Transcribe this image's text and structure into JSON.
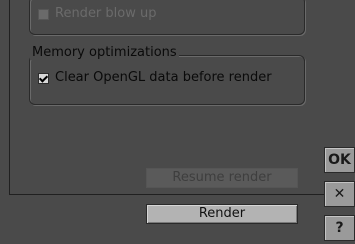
{
  "render_blowup": {
    "label": "Render blow up",
    "checked": false,
    "enabled": false
  },
  "memory": {
    "title": "Memory optimizations",
    "clear_gl": {
      "label": "Clear OpenGL data before render",
      "checked": true
    }
  },
  "buttons": {
    "resume": "Resume render",
    "render": "Render"
  },
  "side": {
    "ok": "OK",
    "close": "✕",
    "help": "?"
  }
}
